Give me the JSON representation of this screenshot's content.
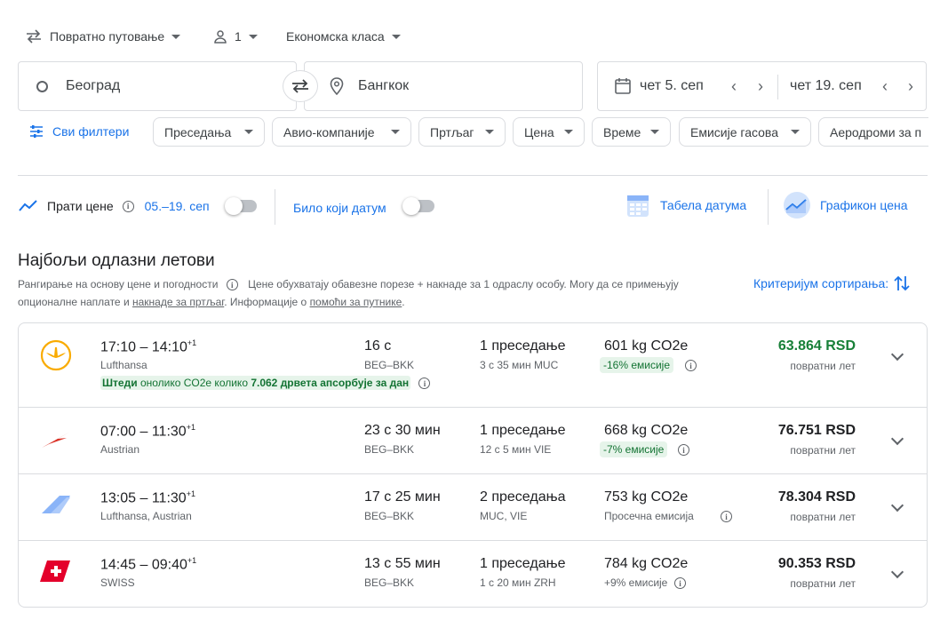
{
  "search": {
    "trip_type": "Повратно путовање",
    "passengers": "1",
    "cabin_class": "Економска класа",
    "origin": "Београд",
    "destination": "Бангкок",
    "depart_date": "чет 5. сеп",
    "return_date": "чет 19. сеп"
  },
  "filters": {
    "all_filters": "Сви филтери",
    "chips": [
      "Преседања",
      "Авио-компаније",
      "Пртљаг",
      "Цена",
      "Време",
      "Емисије гасова",
      "Аеродроми за п"
    ]
  },
  "tracking": {
    "track_prices": "Прати цене",
    "date_range": "05.–19. сеп",
    "any_date": "Било који датум",
    "date_grid": "Табела датума",
    "price_graph": "Графикон цена"
  },
  "results": {
    "heading": "Најбољи одлазни летови",
    "ranking_note": "Рангирање на основу цене и погодности",
    "price_note_1": "Цене обухватају обавезне порезе + накнаде за 1 одраслу особу. Могу да се примењују",
    "price_note_2a": "опционалне наплате и ",
    "price_note_link1": "накнаде за пртљаг",
    "price_note_2b": ". Информације о ",
    "price_note_link2": "помоћи за путнике",
    "price_note_2c": ".",
    "sort_label": "Критеријум сортирања:"
  },
  "flights": [
    {
      "times": "17:10 – 14:10",
      "day_offset": "+1",
      "airline": "Lufthansa",
      "duration": "16 с",
      "route": "BEG–BKK",
      "stops": "1 преседање",
      "stop_detail": "3 с 35 мин MUC",
      "emissions": "601 kg CO2e",
      "emissions_note": "-16% емисије",
      "price": "63.864 RSD",
      "price_label": "повратни лет",
      "eco_prefix": "Штеди",
      "eco_middle": " онолико CO2e колико ",
      "eco_trees": "7.062 дрвета апсорбује за дан",
      "price_color": "#188038"
    },
    {
      "times": "07:00 – 11:30",
      "day_offset": "+1",
      "airline": "Austrian",
      "duration": "23 с 30 мин",
      "route": "BEG–BKK",
      "stops": "1 преседање",
      "stop_detail": "12 с 5 мин VIE",
      "emissions": "668 kg CO2e",
      "emissions_note": "-7% емисије",
      "price": "76.751 RSD",
      "price_label": "повратни лет"
    },
    {
      "times": "13:05 – 11:30",
      "day_offset": "+1",
      "airline": "Lufthansa, Austrian",
      "duration": "17 с 25 мин",
      "route": "BEG–BKK",
      "stops": "2 преседања",
      "stop_detail": "MUC, VIE",
      "emissions": "753 kg CO2e",
      "emissions_note": "Просечна емисија",
      "price": "78.304 RSD",
      "price_label": "повратни лет"
    },
    {
      "times": "14:45 – 09:40",
      "day_offset": "+1",
      "airline": "SWISS",
      "duration": "13 с 55 мин",
      "route": "BEG–BKK",
      "stops": "1 преседање",
      "stop_detail": "1 с 20 мин ZRH",
      "emissions": "784 kg CO2e",
      "emissions_note": "+9% емисије",
      "price": "90.353 RSD",
      "price_label": "повратни лет"
    }
  ],
  "colors": {
    "accent": "#1a73e8",
    "green": "#188038",
    "border": "#dadce0"
  }
}
